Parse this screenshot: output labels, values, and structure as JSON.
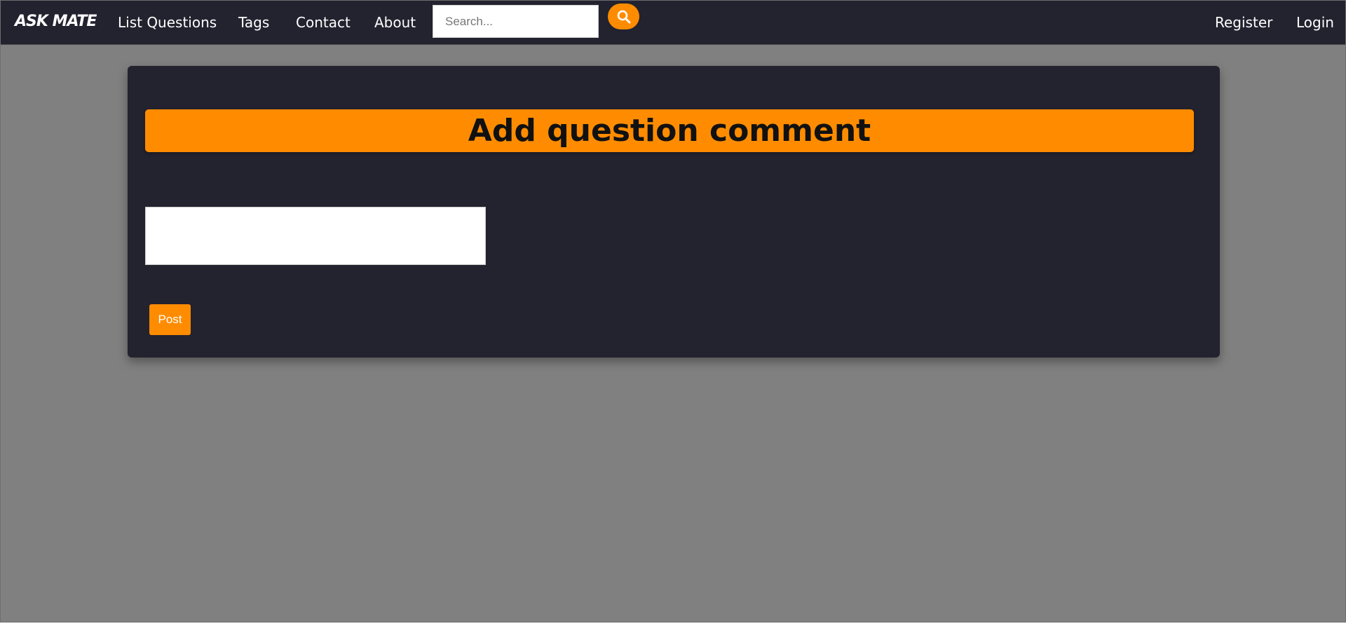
{
  "navbar": {
    "logo": "ASK MATE",
    "links": {
      "list_questions": "List Questions",
      "tags": "Tags",
      "contact": "Contact",
      "about": "About",
      "register": "Register",
      "login": "Login"
    },
    "search": {
      "placeholder": "Search...",
      "value": "",
      "button_icon": "search-icon"
    }
  },
  "main": {
    "title": "Add question comment",
    "comment_field": {
      "value": ""
    },
    "post_label": "Post"
  },
  "colors": {
    "navbar_bg": "#23222f",
    "page_bg": "#808080",
    "card_bg": "#23222f",
    "accent": "#ff8c00"
  }
}
